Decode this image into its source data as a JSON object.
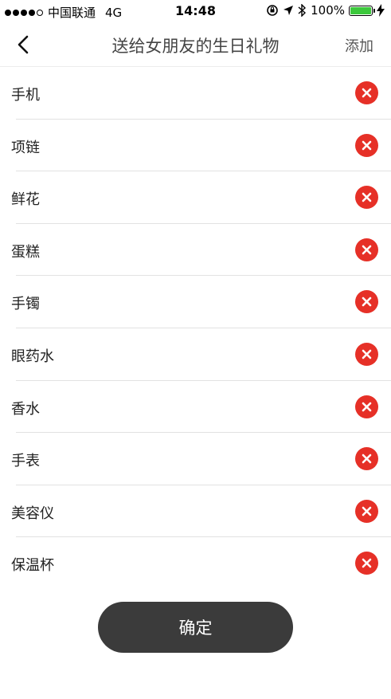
{
  "status_bar": {
    "carrier": "中国联通",
    "network": "4G",
    "time": "14:48",
    "battery_text": "100%",
    "battery_level": 1.0,
    "battery_color": "#3cc83c"
  },
  "nav": {
    "title": "送给女朋友的生日礼物",
    "add_label": "添加"
  },
  "items": [
    {
      "label": "手机"
    },
    {
      "label": "项链"
    },
    {
      "label": "鲜花"
    },
    {
      "label": "蛋糕"
    },
    {
      "label": "手镯"
    },
    {
      "label": "眼药水"
    },
    {
      "label": "香水"
    },
    {
      "label": "手表"
    },
    {
      "label": "美容仪"
    },
    {
      "label": "保温杯"
    }
  ],
  "confirm_label": "确定",
  "colors": {
    "remove": "#e63027",
    "confirm_bg": "#3b3b3b"
  },
  "icons": {
    "back": "chevron-left-icon",
    "remove": "close-circle-icon"
  }
}
